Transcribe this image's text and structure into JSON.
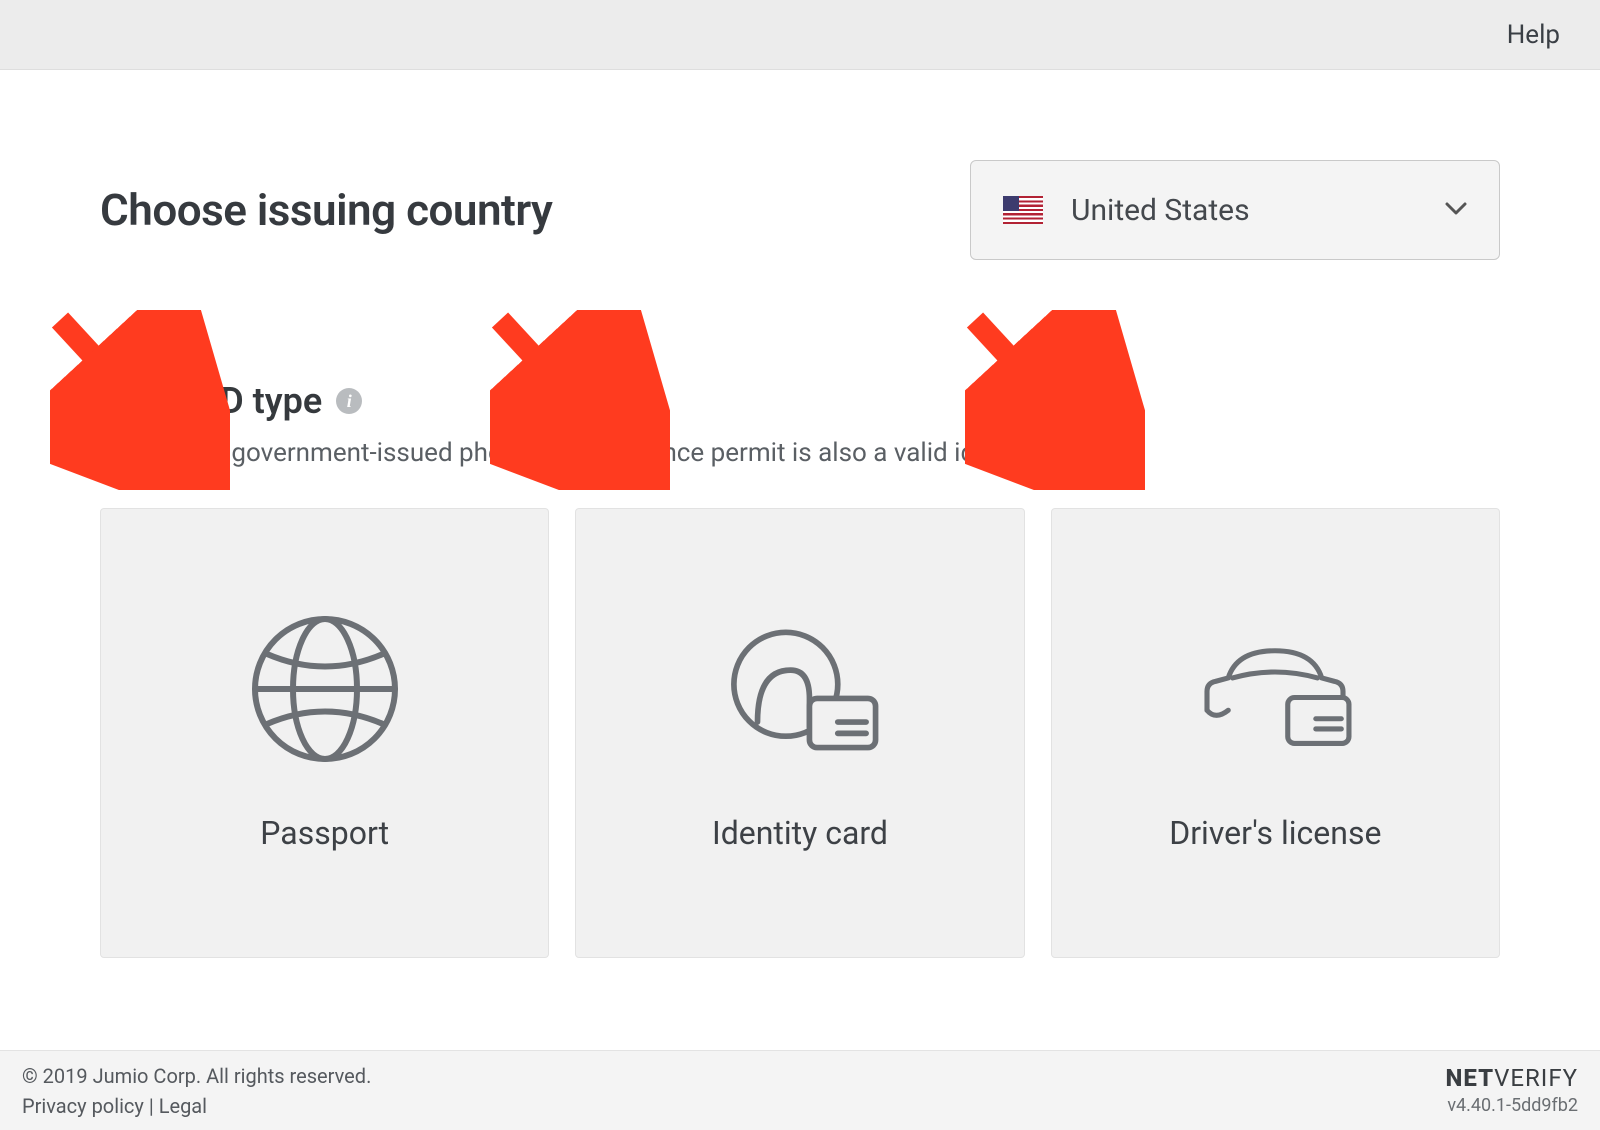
{
  "topbar": {
    "help": "Help"
  },
  "country": {
    "heading": "Choose issuing country",
    "selected": "United States"
  },
  "idtype": {
    "heading": "Select ID type",
    "info_glyph": "i",
    "description": "Use a valid government-issued photo ID. A residence permit is also a valid identity card."
  },
  "cards": [
    {
      "label": "Passport",
      "icon": "globe-icon"
    },
    {
      "label": "Identity card",
      "icon": "id-card-icon"
    },
    {
      "label": "Driver's license",
      "icon": "car-card-icon"
    }
  ],
  "footer": {
    "copyright": "© 2019 Jumio Corp. All rights reserved.",
    "privacy": "Privacy policy",
    "sep": " | ",
    "legal": "Legal",
    "brand_bold": "NET",
    "brand_light": "VERIFY",
    "version": "v4.40.1-5dd9fb2"
  }
}
